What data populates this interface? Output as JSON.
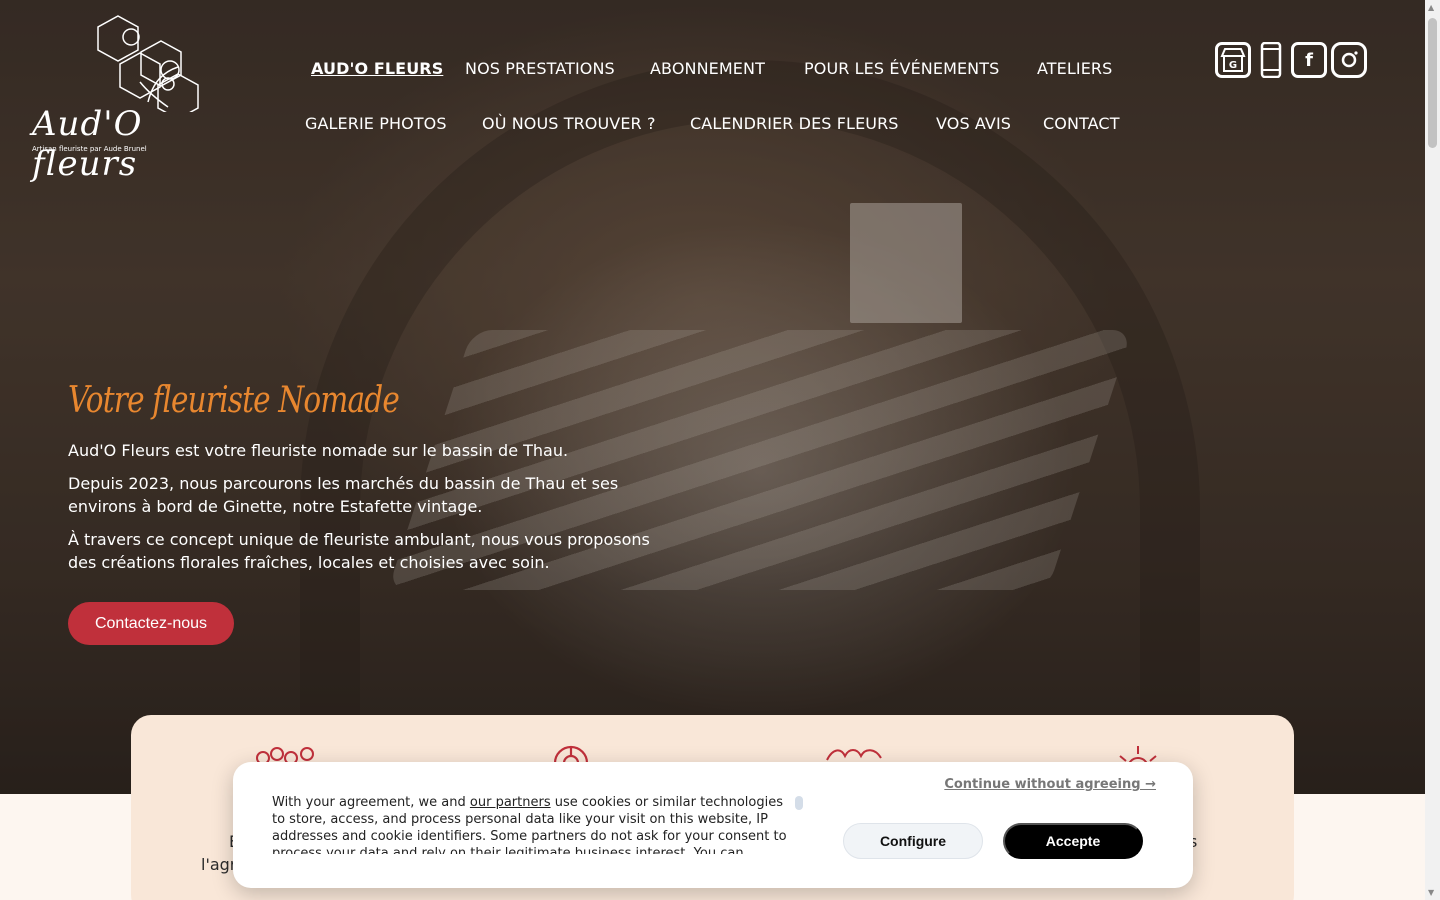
{
  "logo": {
    "name": "Aud'O fleurs",
    "tagline": "Artisan fleuriste par Aude Brunel"
  },
  "nav": {
    "items": [
      {
        "label": "AUD'O FLEURS",
        "active": true
      },
      {
        "label": "NOS PRESTATIONS"
      },
      {
        "label": "ABONNEMENT"
      },
      {
        "label": "POUR LES ÉVÉNEMENTS"
      },
      {
        "label": "ATELIERS"
      },
      {
        "label": "GALERIE PHOTOS"
      },
      {
        "label": "OÙ NOUS TROUVER ?"
      },
      {
        "label": "CALENDRIER DES FLEURS"
      },
      {
        "label": "VOS AVIS"
      },
      {
        "label": "CONTACT"
      }
    ]
  },
  "social": {
    "icons": [
      "google-business-icon",
      "phone-icon",
      "facebook-icon",
      "instagram-icon"
    ],
    "google_letter": "G",
    "facebook_letter": "f"
  },
  "hero": {
    "title": "Votre fleuriste Nomade",
    "p1": "Aud'O Fleurs est votre fleuriste nomade sur le bassin de Thau.",
    "p2": "Depuis 2023, nous parcourons les marchés du bassin de Thau et ses environs à bord de Ginette, notre Estafette vintage.",
    "p3": "À travers ce concept unique de fleuriste ambulant, nous vous proposons des créations florales fraîches, locales et choisies avec soin.",
    "cta": "Contactez-nous"
  },
  "features": {
    "icons": [
      "flowers-icon",
      "target-icon",
      "bouquet-icon",
      "sun-icon"
    ],
    "visible_text_left": "E",
    "visible_text_left2": "l'agr",
    "visible_text_right": "s"
  },
  "cookie": {
    "continue": "Continue without agreeing →",
    "text_before": "With your agreement, we and ",
    "partners_link": "our partners",
    "text_after": " use cookies or similar technologies to store, access, and process personal data like your visit on this website, IP addresses and cookie identifiers. Some partners do not ask for your consent to process your data and rely on their legitimate business interest. You can",
    "configure": "Configure",
    "accept": "Accepte"
  },
  "colors": {
    "accent_orange": "#e8872f",
    "cta_red": "#c0303b",
    "card_bg": "#f9e7d8"
  }
}
